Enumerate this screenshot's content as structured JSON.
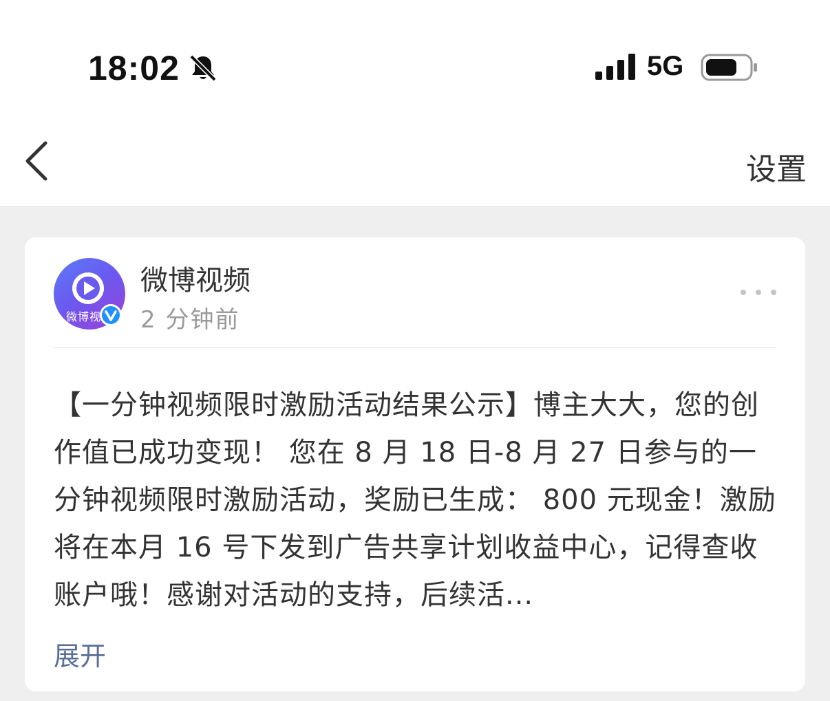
{
  "status_bar": {
    "time": "18:02",
    "network": "5G"
  },
  "nav": {
    "settings_label": "设置"
  },
  "post": {
    "author": "微博视频",
    "avatar_text": "微博视",
    "time_ago": "2 分钟前",
    "content": "【一分钟视频限时激励活动结果公示】博主大大，您的创作值已成功变现！ 您在 8 月 18 日-8 月 27 日参与的一分钟视频限时激励活动，奖励已生成： 800 元现金！激励将在本月 16 号下发到广告共享计划收益中心，记得查收账户哦！感谢对活动的支持，后续活...",
    "expand_label": "展开"
  },
  "colors": {
    "link": "#5a6e9a",
    "verified": "#1e90ff",
    "background": "#efefef"
  }
}
